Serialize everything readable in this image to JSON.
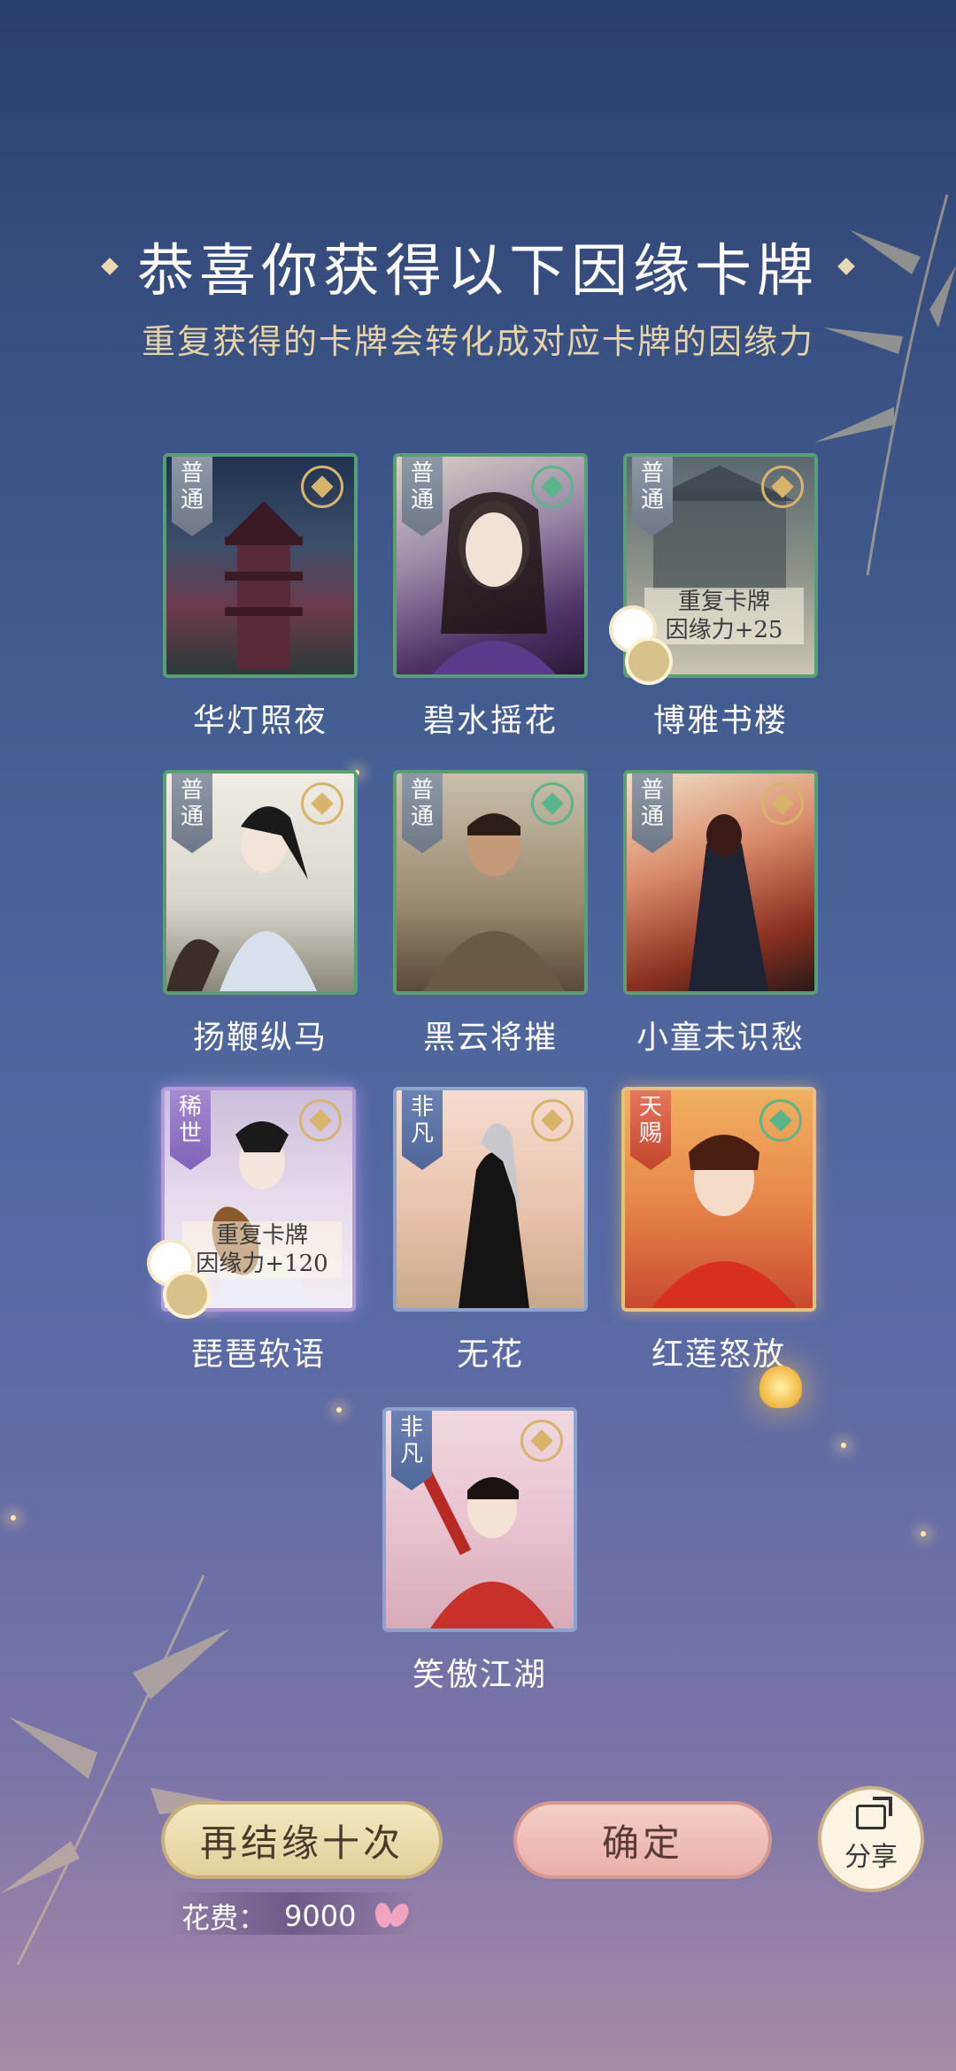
{
  "header": {
    "title": "恭喜你获得以下因缘卡牌",
    "subtitle": "重复获得的卡牌会转化成对应卡牌的因缘力"
  },
  "cards": [
    {
      "name": "华灯照夜",
      "rarity": "普通",
      "duplicate": false
    },
    {
      "name": "碧水摇花",
      "rarity": "普通",
      "duplicate": false
    },
    {
      "name": "博雅书楼",
      "rarity": "普通",
      "duplicate": true,
      "dup_title": "重复卡牌",
      "dup_value": "因缘力+25"
    },
    {
      "name": "扬鞭纵马",
      "rarity": "普通",
      "duplicate": false
    },
    {
      "name": "黑云将摧",
      "rarity": "普通",
      "duplicate": false
    },
    {
      "name": "小童未识愁",
      "rarity": "普通",
      "duplicate": false
    },
    {
      "name": "琵琶软语",
      "rarity": "稀世",
      "duplicate": true,
      "dup_title": "重复卡牌",
      "dup_value": "因缘力+120"
    },
    {
      "name": "无花",
      "rarity": "非凡",
      "duplicate": false
    },
    {
      "name": "红莲怒放",
      "rarity": "天赐",
      "duplicate": false
    },
    {
      "name": "笑傲江湖",
      "rarity": "非凡",
      "duplicate": false
    }
  ],
  "actions": {
    "again_label": "再结缘十次",
    "confirm_label": "确定",
    "share_label": "分享"
  },
  "cost": {
    "label": "花费：",
    "value": "9000",
    "currency_icon": "butterfly-icon"
  },
  "colors": {
    "bg_top": "#2a3f6c",
    "bg_bottom": "#a98aa8",
    "common_border": "#5a9f74",
    "rare_border": "#b39bd8",
    "gold_border": "#e4c27a"
  }
}
